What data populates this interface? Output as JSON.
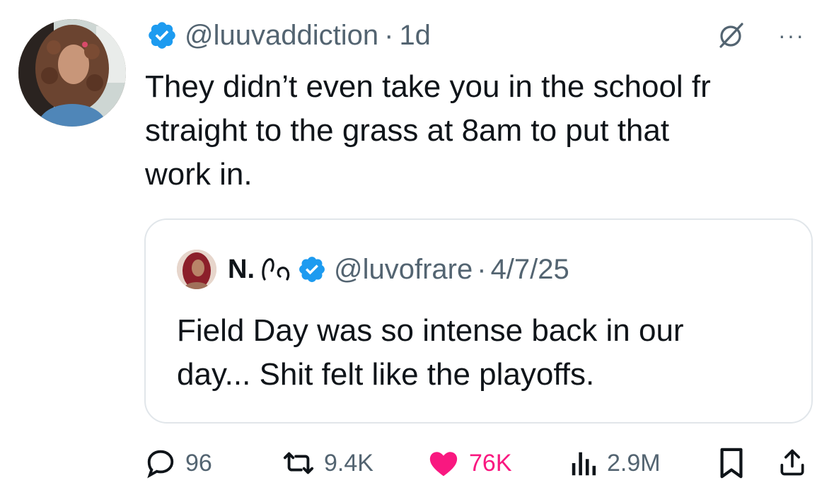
{
  "tweet": {
    "handle": "@luuvaddiction",
    "separator": "·",
    "time": "1d",
    "text": "They didn’t even take you in the school fr\nstraight to the grass at 8am to put that\nwork in.",
    "more_label": "···"
  },
  "quote": {
    "name": "N.",
    "handle": "@luvofrare",
    "separator": "·",
    "date": "4/7/25",
    "text": "Field Day was so intense back in our\nday... Shit felt like the playoffs."
  },
  "actions": {
    "replies": "96",
    "reposts": "9.4K",
    "likes": "76K",
    "views": "2.9M"
  },
  "colors": {
    "verified": "#1d9bf0",
    "secondary_text": "#536471",
    "like": "#f91880",
    "border": "#e1e6ea"
  },
  "icons": [
    "verified-badge-icon",
    "grok-icon",
    "more-icon",
    "reply-icon",
    "repost-icon",
    "like-icon",
    "views-icon",
    "bookmark-icon",
    "share-icon"
  ]
}
